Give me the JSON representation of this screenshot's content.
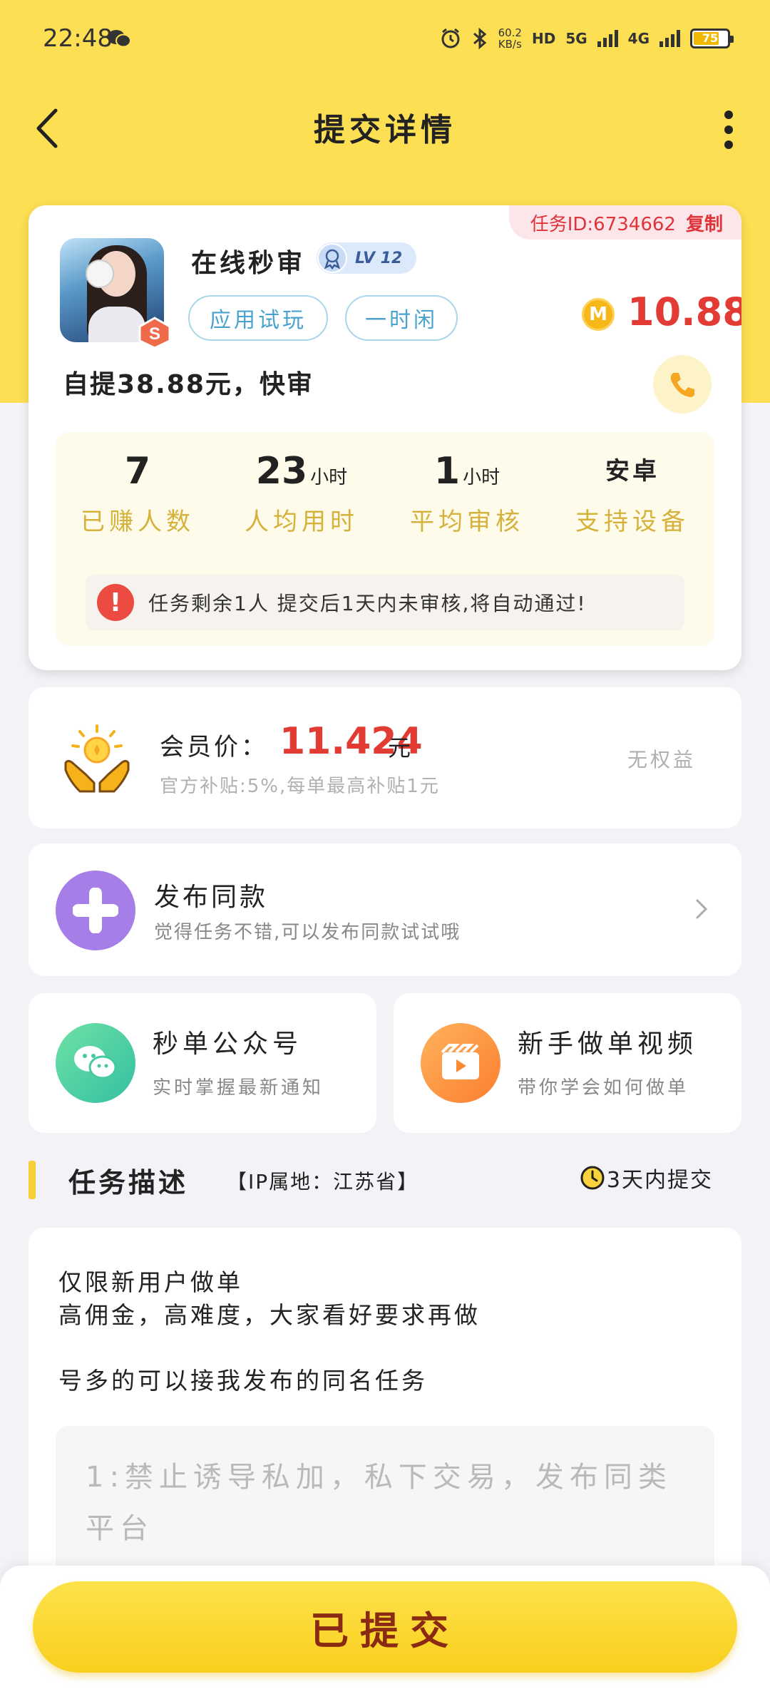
{
  "status_bar": {
    "time": "22:48",
    "net_speed_value": "60.2",
    "net_speed_unit": "KB/s",
    "hd_tag": "HD",
    "net_5g": "5G",
    "net_4g": "4G",
    "battery": "75"
  },
  "header": {
    "title": "提交详情"
  },
  "task_card": {
    "task_id_label": "任务ID:6734662",
    "copy_label": "复制",
    "user_name": "在线秒审",
    "level": "LV 12",
    "tags": [
      "应用试玩",
      "一时闲"
    ],
    "coin_symbol": "M",
    "price": "10.88",
    "description": "自提38.88元，快审",
    "stats": [
      {
        "value": "7",
        "unit": "",
        "label": "已赚人数"
      },
      {
        "value": "23",
        "unit": "小时",
        "label": "人均用时"
      },
      {
        "value": "1",
        "unit": "小时",
        "label": "平均审核"
      },
      {
        "value": "安卓",
        "unit": "",
        "label": "支持设备"
      }
    ],
    "notice": "任务剩余1人  提交后1天内未审核,将自动通过!"
  },
  "member": {
    "label": "会员价：",
    "price": "11.424",
    "unit": "元",
    "subsidy": "官方补贴:5%,每单最高补贴1元",
    "right_text": "无权益"
  },
  "publish": {
    "title": "发布同款",
    "subtitle": "觉得任务不错,可以发布同款试试哦"
  },
  "quick_links": [
    {
      "title": "秒单公众号",
      "subtitle": "实时掌握最新通知"
    },
    {
      "title": "新手做单视频",
      "subtitle": "带你学会如何做单"
    }
  ],
  "section": {
    "title": "任务描述",
    "ip_location": "【IP属地：江苏省】",
    "deadline": "3天内提交"
  },
  "task_description": {
    "lines": [
      "仅限新用户做单",
      "高佣金，高难度，大家看好要求再做",
      "号多的可以接我发布的同名任务"
    ],
    "rules": "1:禁止诱导私加，私下交易，发布同类平台"
  },
  "bottom": {
    "submit_label": "已提交"
  },
  "colors": {
    "brand_yellow": "#fcdf53",
    "price_red": "#e23b33",
    "stat_label_gold": "#d4b23c",
    "tag_blue": "#4aa3cf"
  }
}
